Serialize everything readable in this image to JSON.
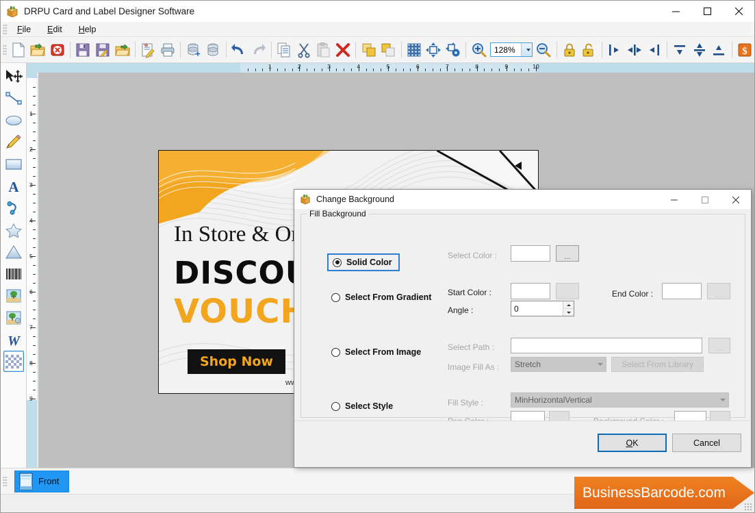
{
  "window": {
    "title": "DRPU Card and Label Designer Software",
    "icon": "app-box-icon",
    "controls": {
      "minimize": "—",
      "maximize": "☐",
      "close": "✕"
    }
  },
  "menu": {
    "items": [
      {
        "label": "File",
        "mnemonic": "F"
      },
      {
        "label": "Edit",
        "mnemonic": "E"
      },
      {
        "label": "Help",
        "mnemonic": "H"
      }
    ]
  },
  "toolbar": {
    "zoom_value": "128%",
    "buttons": [
      {
        "name": "new-document-icon",
        "tip": "New"
      },
      {
        "name": "open-folder-icon",
        "tip": "Open"
      },
      {
        "name": "close-document-icon",
        "tip": "Close"
      },
      {
        "name": "save-icon",
        "tip": "Save"
      },
      {
        "name": "save-as-icon",
        "tip": "Save As"
      },
      {
        "name": "export-folder-icon",
        "tip": "Export"
      },
      {
        "name": "edit-document-icon",
        "tip": "Edit"
      },
      {
        "name": "print-icon",
        "tip": "Print"
      },
      {
        "name": "database-add-icon",
        "tip": "Add Database"
      },
      {
        "name": "database-icon",
        "tip": "Database"
      },
      {
        "name": "undo-icon",
        "tip": "Undo"
      },
      {
        "name": "redo-icon",
        "tip": "Redo"
      },
      {
        "name": "copy-icon",
        "tip": "Copy"
      },
      {
        "name": "cut-scissors-icon",
        "tip": "Cut"
      },
      {
        "name": "paste-icon",
        "tip": "Paste"
      },
      {
        "name": "delete-x-icon",
        "tip": "Delete"
      },
      {
        "name": "bring-to-front-icon",
        "tip": "Bring To Front"
      },
      {
        "name": "send-to-back-icon",
        "tip": "Send To Back"
      },
      {
        "name": "grid-icon",
        "tip": "Grid"
      },
      {
        "name": "move-object-icon",
        "tip": "Move"
      },
      {
        "name": "object-settings-icon",
        "tip": "Object Settings"
      },
      {
        "name": "zoom-in-icon",
        "tip": "Zoom In"
      },
      {
        "name": "zoom-out-icon",
        "tip": "Zoom Out"
      },
      {
        "name": "lock-icon",
        "tip": "Lock"
      },
      {
        "name": "unlock-icon",
        "tip": "Unlock"
      },
      {
        "name": "align-left-icon",
        "tip": "Align Left"
      },
      {
        "name": "align-center-horizontal-icon",
        "tip": "Align Center"
      },
      {
        "name": "align-right-icon",
        "tip": "Align Right"
      },
      {
        "name": "align-top-icon",
        "tip": "Align Top"
      },
      {
        "name": "align-middle-icon",
        "tip": "Align Middle"
      },
      {
        "name": "align-bottom-icon",
        "tip": "Align Bottom"
      },
      {
        "name": "currency-icon",
        "tip": "Currency"
      }
    ]
  },
  "tools": {
    "items": [
      {
        "name": "select-move-tool",
        "label": "Select"
      },
      {
        "name": "line-tool",
        "label": "Line"
      },
      {
        "name": "ellipse-tool",
        "label": "Ellipse"
      },
      {
        "name": "pencil-tool",
        "label": "Pencil"
      },
      {
        "name": "rectangle-tool",
        "label": "Rectangle"
      },
      {
        "name": "text-tool",
        "label": "Text"
      },
      {
        "name": "arc-tool",
        "label": "Arc"
      },
      {
        "name": "star-tool",
        "label": "Star"
      },
      {
        "name": "triangle-tool",
        "label": "Triangle"
      },
      {
        "name": "barcode-tool",
        "label": "Barcode"
      },
      {
        "name": "image-tool",
        "label": "Image"
      },
      {
        "name": "watermark-tool",
        "label": "Watermark"
      },
      {
        "name": "wordart-tool",
        "label": "WordArt"
      },
      {
        "name": "background-tool",
        "label": "Background"
      }
    ],
    "selected": "background-tool"
  },
  "rulers": {
    "horizontal": {
      "labels": [
        "1",
        "2",
        "3",
        "4",
        "5",
        "6",
        "7",
        "8",
        "9",
        "10"
      ],
      "unit": "inch"
    },
    "vertical": {
      "labels": [
        "1",
        "2",
        "3",
        "4",
        "5",
        "6",
        "7",
        "8",
        "9"
      ],
      "unit": "inch"
    }
  },
  "card": {
    "headline": "In Store & Online",
    "title": "DISCOUNT",
    "subtitle": "VOUCHER",
    "button_label": "Shop Now",
    "website": "www.yoursite.com",
    "accent_color": "#f2a51f",
    "text_color": "#0d0d0d"
  },
  "pages": {
    "tabs": [
      {
        "label": "Front",
        "icon": "card-page-icon",
        "selected": true
      }
    ]
  },
  "branding": {
    "text": "BusinessBarcode.com",
    "color": "#e8721d"
  },
  "dialog": {
    "title": "Change Background",
    "icon": "app-box-icon",
    "controls": {
      "minimize": "—",
      "maximize": "☐",
      "close": "✕"
    },
    "group_label": "Fill Background",
    "options": {
      "solid": {
        "label": "Solid Color",
        "selected": true,
        "select_color_label": "Select Color :",
        "select_color_value": "",
        "ellipsis": "..."
      },
      "gradient": {
        "label": "Select From Gradient",
        "selected": false,
        "start_color_label": "Start Color :",
        "start_color_value": "",
        "end_color_label": "End Color :",
        "end_color_value": "",
        "angle_label": "Angle :",
        "angle_value": "0",
        "ellipsis": "..."
      },
      "image": {
        "label": "Select From Image",
        "selected": false,
        "select_path_label": "Select Path :",
        "select_path_value": "",
        "image_fill_as_label": "Image Fill As :",
        "image_fill_as_value": "Stretch",
        "library_button": "Select From Library",
        "ellipsis": "..."
      },
      "style": {
        "label": "Select Style",
        "selected": false,
        "fill_style_label": "Fill Style :",
        "fill_style_value": "MinHorizontalVertical",
        "pen_color_label": "Pen Color :",
        "pen_color_value": "",
        "background_color_label": "Background Color :",
        "background_color_value": "",
        "ellipsis": "..."
      }
    },
    "buttons": {
      "ok": "OK",
      "ok_mnemonic": "O",
      "cancel": "Cancel"
    }
  }
}
